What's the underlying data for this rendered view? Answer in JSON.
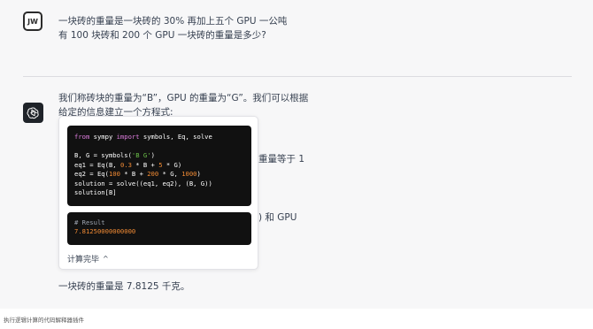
{
  "user": {
    "avatar_text": "JW",
    "message": "一块砖的重量是一块砖的 30% 再加上五个 GPU 一公吨有 100 块砖和 200 个 GPU 一块砖的重量是多少?"
  },
  "assistant": {
    "avatar_icon": "openai-logo-icon",
    "intro": "我们称砖块的重量为“B”，GPU 的重量为“G”。我们可以根据给定的信息建立一个方程式:",
    "fragment_1": "重量等于 1",
    "fragment_2": ") 和 GPU",
    "answer": "一块砖的重量是 7.8125 千克。"
  },
  "code_interpreter": {
    "code_lines": [
      "from sympy import symbols, Eq, solve",
      "",
      "B, G = symbols('B G')",
      "eq1 = Eq(B, 0.3 * B + 5 * G)",
      "eq2 = Eq(100 * B + 200 * G, 1000)",
      "solution = solve((eq1, eq2), (B, G))",
      "solution[B]"
    ],
    "result_comment": "# Result",
    "result_value": "7.81250000000000",
    "status_label": "计算完毕",
    "status_chevron": "^"
  },
  "caption": "执行逻辑计算的代码解释器插件",
  "colors": {
    "chat_background": "#f7f7f8",
    "code_background": "#111111",
    "keyword": "#e07ee0",
    "string": "#6cc04a",
    "number": "#f28b34"
  }
}
